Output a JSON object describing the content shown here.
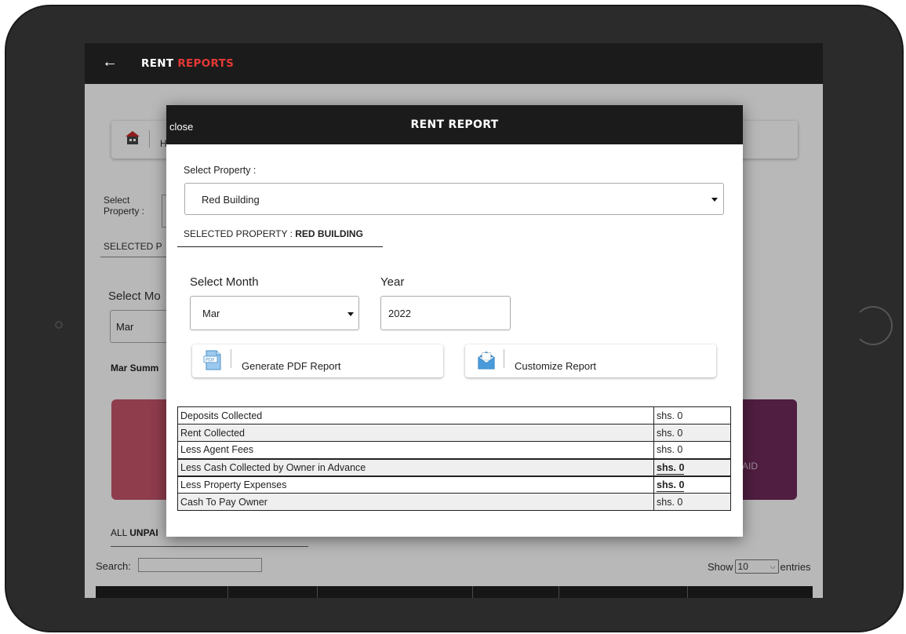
{
  "app": {
    "title_part1": "RENT",
    "title_part2": "REPORTS",
    "accent_color": "#e53935",
    "back_icon": "arrow-left-icon"
  },
  "background": {
    "card_text": "H",
    "select_property_label": "Select Property :",
    "selected_prefix": "SELECTED P",
    "select_month_label": "Select Mo",
    "month_value": "Mar",
    "summary_label": "Mar Summ",
    "card_right_text": "AID",
    "all_unpaid_prefix": "ALL ",
    "all_unpaid_bold": "UNPAI",
    "search_label": "Search:",
    "show_label": "Show",
    "show_value": "10",
    "entries_label": "entries"
  },
  "modal": {
    "close_label": "close",
    "title": "RENT REPORT",
    "property_label": "Select Property :",
    "property_value": "Red Building",
    "selected_property_label": "SELECTED PROPERTY : ",
    "selected_property_value": "RED BUILDING",
    "month_label": "Select Month",
    "month_value": "Mar",
    "year_label": "Year",
    "year_value": "2022",
    "pdf_button": "Generate PDF Report",
    "customize_button": "Customize Report"
  },
  "report_rows": [
    {
      "label": "Deposits Collected",
      "amount": "shs. 0",
      "bold": false
    },
    {
      "label": "Rent Collected",
      "amount": "shs. 0",
      "bold": false
    },
    {
      "label": "Less Agent Fees",
      "amount": "shs. 0",
      "bold": false
    },
    {
      "label": "Less Cash Collected by Owner in Advance",
      "amount": "shs. 0",
      "bold": true
    },
    {
      "label": "Less Property Expenses",
      "amount": "shs. 0",
      "bold": true
    },
    {
      "label": "Cash To Pay Owner",
      "amount": "shs. 0",
      "bold": false
    }
  ]
}
